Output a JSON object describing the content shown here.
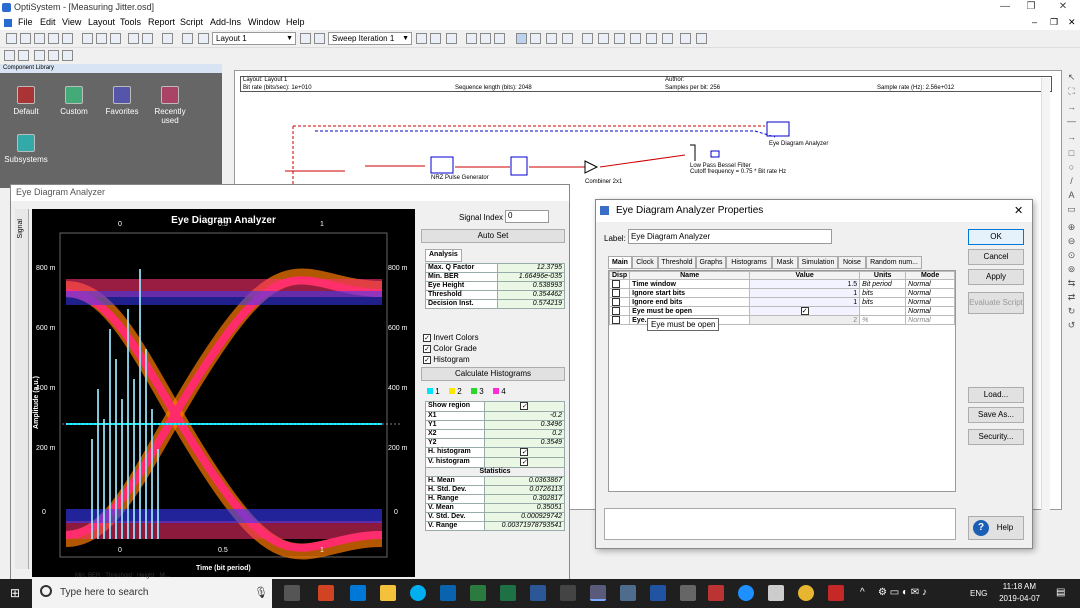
{
  "window": {
    "title": "OptiSystem - [Measuring Jitter.osd]"
  },
  "menu": [
    "File",
    "Edit",
    "View",
    "Layout",
    "Tools",
    "Report",
    "Script",
    "Add-Ins",
    "Window",
    "Help"
  ],
  "toolbar": {
    "layout_combo": "Layout 1",
    "sweep_combo": "Sweep Iteration 1"
  },
  "component_library": {
    "header": "Component Library",
    "items": [
      "Default",
      "Custom",
      "Favorites",
      "Recently used",
      "Subsystems"
    ]
  },
  "layout_header": {
    "layout": "Layout: Layout 1",
    "author": "Author:",
    "bit_rate": "Bit rate (bits/sec): 1e+010",
    "sequence_length": "Sequence length (bits): 2048",
    "samples_per_bit": "Samples per bit: 256",
    "sample_rate": "Sample rate (Hz): 2.56e+012"
  },
  "schematic": {
    "eye_label": "Eye Diagram Analyzer",
    "nrz_label": "NRZ Pulse Generator",
    "combiner_label": "Combiner 2x1",
    "filter_label": "Low Pass Bessel Filter",
    "filter_sub": "Cutoff frequency = 0.75 * Bit rate Hz"
  },
  "eda": {
    "title": "Eye Diagram Analyzer",
    "side_tab": "Signal",
    "plot_title": "Eye Diagram Analyzer",
    "x_axis": "Time (bit period)",
    "y_axis": "Amplitude (a.u.)",
    "x_ticks": [
      "0",
      "0.5",
      "1"
    ],
    "y_ticks_left": [
      "800 m",
      "600 m",
      "400 m",
      "200 m",
      "0"
    ],
    "y_ticks_right": [
      "800 m",
      "600 m",
      "400 m",
      "200 m",
      "0"
    ],
    "signal_index_label": "Signal Index",
    "signal_index_value": "0",
    "auto_set": "Auto Set",
    "analysis_tab": "Analysis",
    "analysis": [
      [
        "Max. Q Factor",
        "12.3795"
      ],
      [
        "Min. BER",
        "1.66496e-035"
      ],
      [
        "Eye Height",
        "0.538993"
      ],
      [
        "Threshold",
        "0.354462"
      ],
      [
        "Decision Inst.",
        "0.574219"
      ]
    ],
    "invert_colors": "Invert Colors",
    "color_grade": "Color Grade",
    "histogram": "Histogram",
    "calc_histograms": "Calculate Histograms",
    "hist_tabs": [
      "1",
      "2",
      "3",
      "4"
    ],
    "region_rows": [
      [
        "Show region",
        "check"
      ],
      [
        "X1",
        "-0.2"
      ],
      [
        "Y1",
        "0.3496"
      ],
      [
        "X2",
        "0.2"
      ],
      [
        "Y2",
        "0.3549"
      ],
      [
        "H. histogram",
        "check"
      ],
      [
        "V. histogram",
        "check"
      ]
    ],
    "statistics_header": "Statistics",
    "statistics": [
      [
        "H. Mean",
        "0.0363867"
      ],
      [
        "H. Std. Dev.",
        "0.0726113"
      ],
      [
        "H. Range",
        "0.302817"
      ],
      [
        "V. Mean",
        "0.35051"
      ],
      [
        "V. Std. Dev.",
        "0.000929742"
      ],
      [
        "V. Range",
        "0.00371978793541"
      ]
    ],
    "bottom_tabs": [
      "Min. BER",
      "Threshold",
      "Height",
      "Mi..."
    ]
  },
  "properties": {
    "title": "Eye Diagram Analyzer Properties",
    "label_caption": "Label:",
    "label_value": "Eye Diagram Analyzer",
    "tabs": [
      "Main",
      "Clock",
      "Threshold",
      "Graphs",
      "Histograms",
      "Mask",
      "Simulation",
      "Noise",
      "Random num..."
    ],
    "columns": [
      "Disp",
      "Name",
      "Value",
      "Units",
      "Mode"
    ],
    "rows": [
      [
        "Time window",
        "1.5",
        "Bit period",
        "Normal"
      ],
      [
        "Ignore start bits",
        "1",
        "bits",
        "Normal"
      ],
      [
        "Ignore end bits",
        "1",
        "bits",
        "Normal"
      ],
      [
        "Eye must be open",
        "",
        "",
        "Normal"
      ],
      [
        "Eye...",
        "2",
        "%",
        "Normal"
      ]
    ],
    "tooltip": "Eye must be open",
    "buttons": {
      "ok": "OK",
      "cancel": "Cancel",
      "apply": "Apply",
      "evaluate": "Evaluate Script",
      "load": "Load...",
      "save_as": "Save As...",
      "security": "Security...",
      "help": "Help"
    }
  },
  "taskbar": {
    "search_placeholder": "Type here to search",
    "lang": "ENG",
    "time": "11:18 AM",
    "date": "2019-04-07"
  }
}
